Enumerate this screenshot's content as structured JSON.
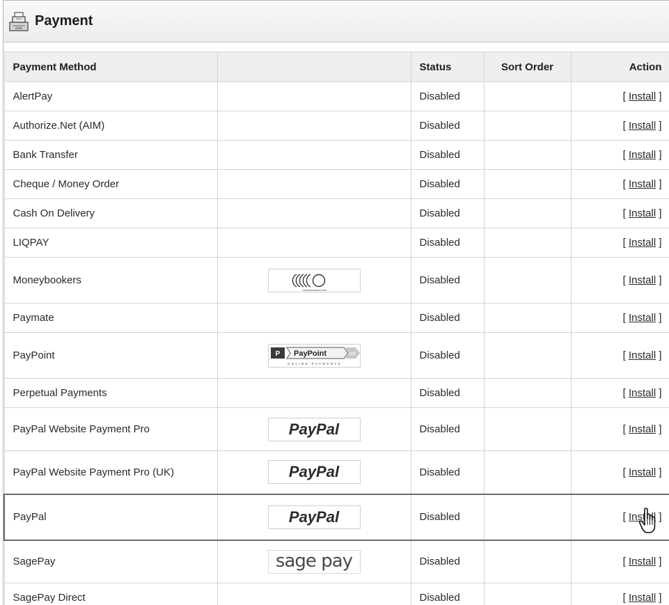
{
  "heading": {
    "title": "Payment",
    "icon": "cash-register-icon"
  },
  "table": {
    "headers": {
      "method": "Payment Method",
      "logo": "",
      "status": "Status",
      "sort": "Sort Order",
      "action": "Action"
    },
    "rows": [
      {
        "name": "AlertPay",
        "logo": "",
        "status": "Disabled",
        "sort": "",
        "pre": "[ ",
        "action": "Install",
        "post": " ]"
      },
      {
        "name": "Authorize.Net (AIM)",
        "logo": "",
        "status": "Disabled",
        "sort": "",
        "pre": "[ ",
        "action": "Install",
        "post": " ]"
      },
      {
        "name": "Bank Transfer",
        "logo": "",
        "status": "Disabled",
        "sort": "",
        "pre": "[ ",
        "action": "Install",
        "post": " ]"
      },
      {
        "name": "Cheque / Money Order",
        "logo": "",
        "status": "Disabled",
        "sort": "",
        "pre": "[ ",
        "action": "Install",
        "post": " ]"
      },
      {
        "name": "Cash On Delivery",
        "logo": "",
        "status": "Disabled",
        "sort": "",
        "pre": "[ ",
        "action": "Install",
        "post": " ]"
      },
      {
        "name": "LIQPAY",
        "logo": "",
        "status": "Disabled",
        "sort": "",
        "pre": "[ ",
        "action": "Install",
        "post": " ]"
      },
      {
        "name": "Moneybookers",
        "logo": "moneybookers",
        "logo_text": "moneybookers.com",
        "status": "Disabled",
        "sort": "",
        "pre": "[ ",
        "action": "Install",
        "post": " ]"
      },
      {
        "name": "Paymate",
        "logo": "",
        "status": "Disabled",
        "sort": "",
        "pre": "[ ",
        "action": "Install",
        "post": " ]"
      },
      {
        "name": "PayPoint",
        "logo": "paypoint",
        "logo_text": "PayPoint",
        "logo_text2": "net",
        "logo_sub": "ONLINE PAYMENTS",
        "status": "Disabled",
        "sort": "",
        "pre": "[ ",
        "action": "Install",
        "post": " ]"
      },
      {
        "name": "Perpetual Payments",
        "logo": "",
        "status": "Disabled",
        "sort": "",
        "pre": "[ ",
        "action": "Install",
        "post": " ]"
      },
      {
        "name": "PayPal Website Payment Pro",
        "logo": "paypal",
        "logo_text": "PayPal",
        "status": "Disabled",
        "sort": "",
        "pre": "[ ",
        "action": "Install",
        "post": " ]"
      },
      {
        "name": "PayPal Website Payment Pro (UK)",
        "logo": "paypal",
        "logo_text": "PayPal",
        "status": "Disabled",
        "sort": "",
        "pre": "[ ",
        "action": "Install",
        "post": " ]"
      },
      {
        "name": "PayPal",
        "logo": "paypal",
        "logo_text": "PayPal",
        "status": "Disabled",
        "sort": "",
        "pre": "[ ",
        "action": "Install",
        "post": " ]",
        "highlighted": true
      },
      {
        "name": "SagePay",
        "logo": "sagepay",
        "logo_text": "sage pay",
        "status": "Disabled",
        "sort": "",
        "pre": "[ ",
        "action": "Install",
        "post": " ]"
      },
      {
        "name": "SagePay Direct",
        "logo": "",
        "status": "Disabled",
        "sort": "",
        "pre": "[ ",
        "action": "Install",
        "post": " ]"
      }
    ]
  },
  "cursor": {
    "icon": "hand-pointer-icon"
  }
}
